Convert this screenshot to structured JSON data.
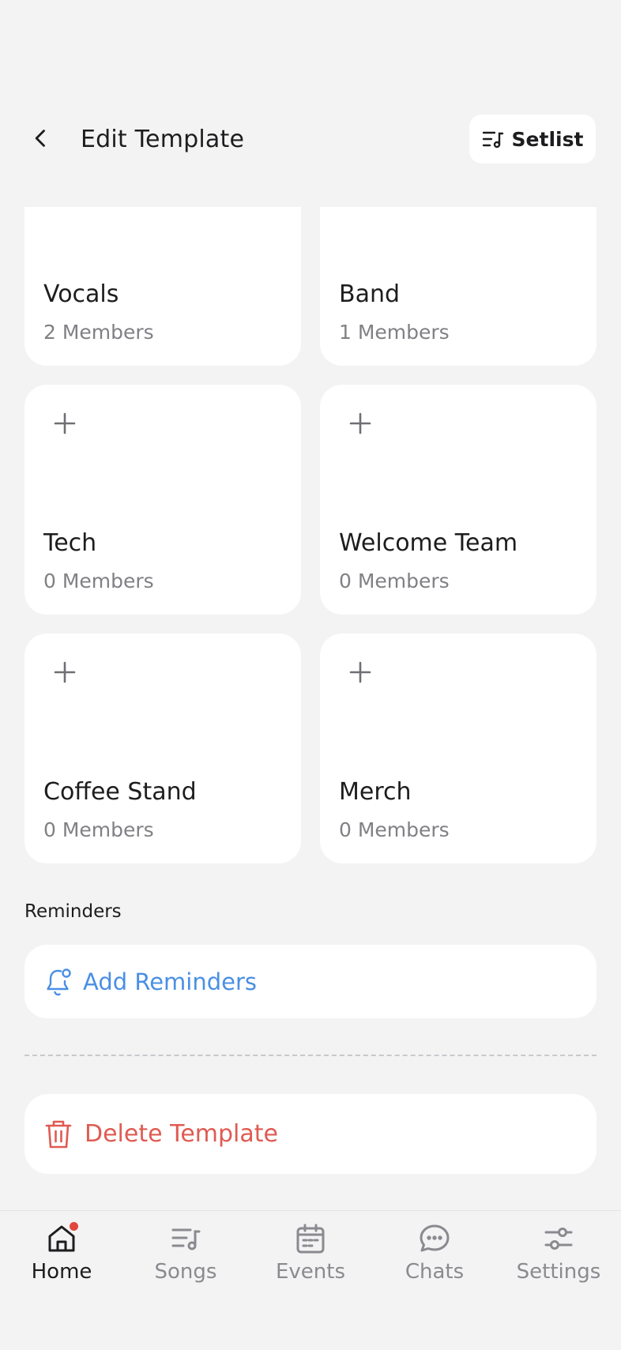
{
  "header": {
    "title": "Edit Template",
    "setlist_label": "Setlist"
  },
  "groups": [
    {
      "name": "Vocals",
      "members": "2 Members"
    },
    {
      "name": "Band",
      "members": "1 Members"
    },
    {
      "name": "Tech",
      "members": "0 Members"
    },
    {
      "name": "Welcome Team",
      "members": "0 Members"
    },
    {
      "name": "Coffee Stand",
      "members": "0 Members"
    },
    {
      "name": "Merch",
      "members": "0 Members"
    }
  ],
  "reminders": {
    "section_label": "Reminders",
    "add_label": "Add Reminders"
  },
  "delete_label": "Delete Template",
  "nav": [
    {
      "label": "Home",
      "icon": "home-icon",
      "active": true
    },
    {
      "label": "Songs",
      "icon": "songs-icon"
    },
    {
      "label": "Events",
      "icon": "calendar-icon"
    },
    {
      "label": "Chats",
      "icon": "chat-icon"
    },
    {
      "label": "Settings",
      "icon": "sliders-icon"
    }
  ],
  "colors": {
    "background": "#f3f3f4",
    "card": "#ffffff",
    "accent_blue": "#4a8fe4",
    "danger_red": "#df5b52",
    "notification_dot": "#e2473e"
  }
}
